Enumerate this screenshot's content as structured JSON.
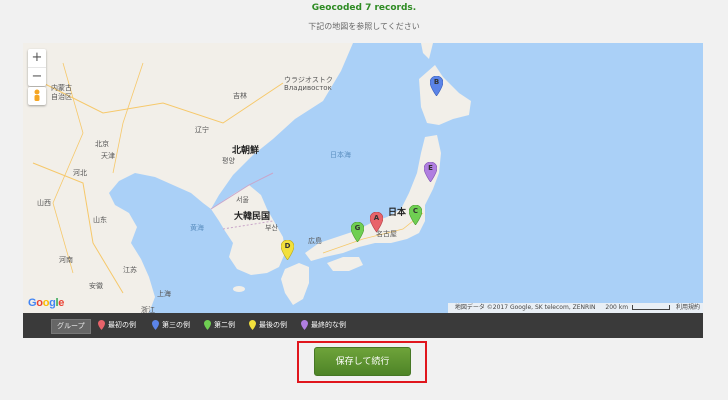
{
  "header": {
    "status": "Geocoded 7 records.",
    "instruction": "下記の地図を参照してください"
  },
  "map": {
    "zoom_in": "+",
    "zoom_out": "−",
    "google": [
      "G",
      "o",
      "o",
      "g",
      "l",
      "e"
    ],
    "attribution": "地図データ ©2017 Google, SK telecom, ZENRIN",
    "scale": "200 km",
    "terms": "利用規約",
    "labels": {
      "vladivostok_ja": "ウラジオストク",
      "vladivostok_ru": "Владивосток",
      "north_korea": "北朝鮮",
      "pyongyang": "평양",
      "south_korea": "大韓民国",
      "seoul": "서울",
      "busan": "부산",
      "japan": "日本",
      "sea_of_japan": "日本海",
      "yellow_sea": "黄海",
      "tianjin": "天津",
      "beijing": "北京",
      "shanghai": "上海",
      "nagoya": "名古屋",
      "hiroshima": "広島",
      "inner_mongolia_1": "内蒙古",
      "inner_mongolia_2": "自治区",
      "hebei": "河北",
      "shanxi": "山西",
      "shandong": "山东",
      "henan": "河南",
      "jiangsu": "江苏",
      "anhui": "安徽",
      "zhejiang": "浙江",
      "jilin": "吉林",
      "liaoning": "辽宁"
    },
    "markers": {
      "a": "A",
      "b": "B",
      "c": "C",
      "d": "D",
      "e": "E",
      "g": "G"
    }
  },
  "legend": {
    "title": "グループ",
    "items": [
      {
        "label": "最初の例",
        "color": "#e8636a"
      },
      {
        "label": "第三の例",
        "color": "#5b84e8"
      },
      {
        "label": "第二例",
        "color": "#6fcf52"
      },
      {
        "label": "最後の例",
        "color": "#f2e03c"
      },
      {
        "label": "最終的な例",
        "color": "#b07ee0"
      }
    ]
  },
  "action": {
    "save_label": "保存して続行"
  },
  "colors": {
    "status": "#2e8b23",
    "water": "#aad0f7",
    "land": "#f2efe9",
    "button": "#5a922e",
    "highlight": "#e0161d"
  }
}
